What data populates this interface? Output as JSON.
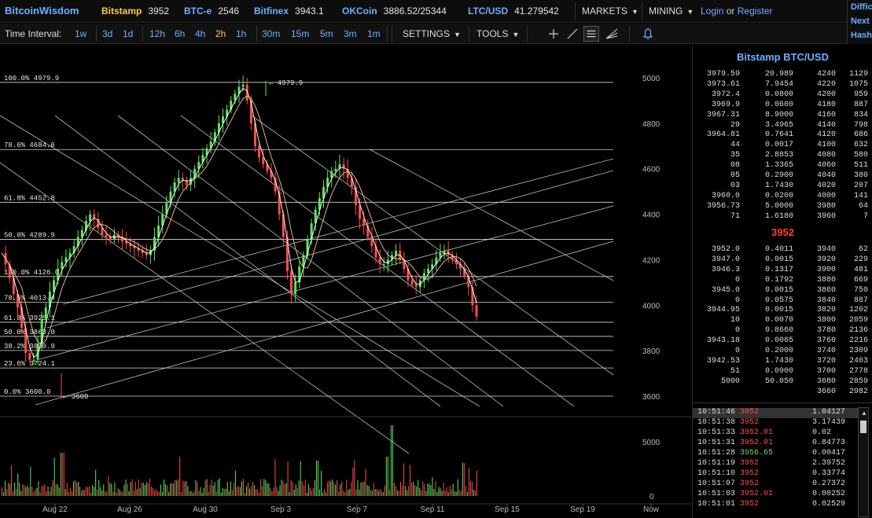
{
  "topbar": {
    "brand": "BitcoinWisdom",
    "tickers": [
      {
        "exchange": "Bitstamp",
        "value": "3952",
        "active": true
      },
      {
        "exchange": "BTC-e",
        "value": "2546",
        "active": false
      },
      {
        "exchange": "Bitfinex",
        "value": "3943.1",
        "active": false
      },
      {
        "exchange": "OKCoin",
        "value": "3886.52/25344",
        "active": false
      },
      {
        "exchange": "LTC/USD",
        "value": "41.279542",
        "active": false
      }
    ],
    "markets_label": "MARKETS",
    "mining_label": "MINING",
    "login_label": "Login",
    "or_label": "or",
    "register_label": "Register",
    "side_items": [
      "Diffic",
      "Next",
      "Hash"
    ]
  },
  "toolbar": {
    "time_interval_label": "Time Interval:",
    "intervals": [
      {
        "label": "1w",
        "active": false
      },
      {
        "label": "3d",
        "active": false
      },
      {
        "label": "1d",
        "active": false
      },
      {
        "label": "12h",
        "active": false
      },
      {
        "label": "6h",
        "active": false
      },
      {
        "label": "4h",
        "active": false
      },
      {
        "label": "2h",
        "active": true
      },
      {
        "label": "1h",
        "active": false
      },
      {
        "label": "30m",
        "active": false
      },
      {
        "label": "15m",
        "active": false
      },
      {
        "label": "5m",
        "active": false
      },
      {
        "label": "3m",
        "active": false
      },
      {
        "label": "1m",
        "active": false
      }
    ],
    "settings_label": "SETTINGS",
    "tools_label": "TOOLS",
    "tool_icons": [
      "crosshair-icon",
      "line-draw-icon",
      "horizontal-lines-icon",
      "fan-lines-icon",
      "alert-bell-icon"
    ]
  },
  "chart_data": {
    "type": "candlestick",
    "price_axis_ticks": [
      "5000",
      "4800",
      "4600",
      "4400",
      "4200",
      "4000",
      "3800",
      "3600"
    ],
    "volume_axis_ticks": [
      "5000",
      "0"
    ],
    "x_tick_labels": [
      "Aug 22",
      "Aug 26",
      "Aug 30",
      "Sep 3",
      "Sep 7",
      "Sep 11",
      "Sep 15",
      "Sep 19",
      "Now"
    ],
    "fib_upper": [
      {
        "label": "100.0% 4979.9",
        "price": 4979.9
      },
      {
        "label": "78.6% 4684.6",
        "price": 4684.6
      },
      {
        "label": "61.8% 4452.8",
        "price": 4452.8
      },
      {
        "label": "50.0% 4289.9",
        "price": 4289.9
      },
      {
        "label": "100.0% 4126.0",
        "price": 4126.0
      }
    ],
    "fib_lower": [
      {
        "label": "78.6% 4013.4",
        "price": 4013.4
      },
      {
        "label": "61.8% 3925.1",
        "price": 3925.1
      },
      {
        "label": "50.0% 3863.0",
        "price": 3863.0
      },
      {
        "label": "38.2% 3800.9",
        "price": 3800.9
      },
      {
        "label": "23.6% 3724.1",
        "price": 3724.1
      },
      {
        "label": "0.0% 3600.0",
        "price": 3600.0
      }
    ],
    "high_marker": "4979.9",
    "low_marker": "3600",
    "ylim": [
      3600,
      5000
    ],
    "price_path": [
      4230,
      4180,
      4120,
      4050,
      3990,
      3900,
      3790,
      3760,
      3760,
      3830,
      3940,
      3990,
      4060,
      4110,
      4160,
      4190,
      4210,
      4230,
      4260,
      4300,
      4330,
      4370,
      4400,
      4380,
      4340,
      4310,
      4300,
      4290,
      4310,
      4300,
      4280,
      4270,
      4260,
      4250,
      4240,
      4230,
      4220,
      4240,
      4300,
      4350,
      4400,
      4450,
      4500,
      4540,
      4560,
      4550,
      4530,
      4560,
      4600,
      4630,
      4660,
      4690,
      4720,
      4760,
      4800,
      4830,
      4860,
      4900,
      4930,
      4960,
      4970,
      4900,
      4800,
      4700,
      4650,
      4620,
      4590,
      4560,
      4500,
      4400,
      4300,
      4150,
      4050,
      4100,
      4170,
      4220,
      4290,
      4360,
      4420,
      4470,
      4520,
      4560,
      4590,
      4600,
      4620,
      4600,
      4560,
      4520,
      4440,
      4380,
      4350,
      4300,
      4260,
      4210,
      4180,
      4180,
      4200,
      4220,
      4240,
      4200,
      4160,
      4110,
      4090,
      4080,
      4110,
      4140,
      4160,
      4180,
      4210,
      4230,
      4240,
      4220,
      4200,
      4180,
      4160,
      4130,
      4080,
      4000,
      3950
    ]
  },
  "orderbook": {
    "title": "Bitstamp BTC/USD",
    "asks": [
      {
        "price": "3979.59",
        "amount": "20.989",
        "sum_price": "4240",
        "sum_amount": "1129"
      },
      {
        "price": "3973.61",
        "amount": "7.9454",
        "sum_price": "4220",
        "sum_amount": "1075"
      },
      {
        "price": "3972.4",
        "amount": "0.0800",
        "sum_price": "4200",
        "sum_amount": "959"
      },
      {
        "price": "3969.9",
        "amount": "0.0600",
        "sum_price": "4180",
        "sum_amount": "887"
      },
      {
        "price": "3967.31",
        "amount": "8.9000",
        "sum_price": "4160",
        "sum_amount": "834"
      },
      {
        "price": "29",
        "amount": "3.4965",
        "sum_price": "4140",
        "sum_amount": "798"
      },
      {
        "price": "3964.81",
        "amount": "0.7641",
        "sum_price": "4120",
        "sum_amount": "686"
      },
      {
        "price": "44",
        "amount": "0.0017",
        "sum_price": "4100",
        "sum_amount": "632"
      },
      {
        "price": "35",
        "amount": "2.8853",
        "sum_price": "4080",
        "sum_amount": "580"
      },
      {
        "price": "08",
        "amount": "1.3365",
        "sum_price": "4060",
        "sum_amount": "511"
      },
      {
        "price": "05",
        "amount": "0.2900",
        "sum_price": "4040",
        "sum_amount": "380"
      },
      {
        "price": "03",
        "amount": "1.7430",
        "sum_price": "4020",
        "sum_amount": "207"
      },
      {
        "price": "3960.0",
        "amount": "0.0200",
        "sum_price": "4000",
        "sum_amount": "141"
      },
      {
        "price": "3956.73",
        "amount": "5.0000",
        "sum_price": "3980",
        "sum_amount": "64"
      },
      {
        "price": "71",
        "amount": "1.6180",
        "sum_price": "3960",
        "sum_amount": "7"
      }
    ],
    "last_price": "3952",
    "bids": [
      {
        "price": "3952.0",
        "amount": "0.4011",
        "sum_price": "3940",
        "sum_amount": "62"
      },
      {
        "price": "3947.0",
        "amount": "0.0015",
        "sum_price": "3920",
        "sum_amount": "229"
      },
      {
        "price": "3946.3",
        "amount": "0.1317",
        "sum_price": "3900",
        "sum_amount": "481"
      },
      {
        "price": "0",
        "amount": "0.1792",
        "sum_price": "3880",
        "sum_amount": "669"
      },
      {
        "price": "3945.0",
        "amount": "0.0015",
        "sum_price": "3860",
        "sum_amount": "750"
      },
      {
        "price": "0",
        "amount": "0.0575",
        "sum_price": "3840",
        "sum_amount": "887"
      },
      {
        "price": "3944.95",
        "amount": "0.0015",
        "sum_price": "3820",
        "sum_amount": "1202"
      },
      {
        "price": "10",
        "amount": "0.0070",
        "sum_price": "3800",
        "sum_amount": "2059"
      },
      {
        "price": "0",
        "amount": "0.8660",
        "sum_price": "3780",
        "sum_amount": "2136"
      },
      {
        "price": "3943.18",
        "amount": "0.0065",
        "sum_price": "3760",
        "sum_amount": "2216"
      },
      {
        "price": "0",
        "amount": "0.2000",
        "sum_price": "3740",
        "sum_amount": "2309"
      },
      {
        "price": "3942.53",
        "amount": "1.7430",
        "sum_price": "3720",
        "sum_amount": "2403"
      },
      {
        "price": "51",
        "amount": "0.0900",
        "sum_price": "3700",
        "sum_amount": "2778"
      },
      {
        "price": "5000",
        "amount": "50.050",
        "sum_price": "3680",
        "sum_amount": "2859"
      },
      {
        "price": "",
        "amount": "",
        "sum_price": "3660",
        "sum_amount": "2982"
      }
    ]
  },
  "trades": [
    {
      "time": "10:51:46",
      "price": "3952",
      "side": "sell",
      "amount": "1.04127"
    },
    {
      "time": "10:51:38",
      "price": "3952",
      "side": "sell",
      "amount": "3.17439"
    },
    {
      "time": "10:51:33",
      "price": "3952.01",
      "side": "sell",
      "amount": "0.02"
    },
    {
      "time": "10:51:31",
      "price": "3952.01",
      "side": "sell",
      "amount": "0.84773"
    },
    {
      "time": "10:51:28",
      "price": "3956.65",
      "side": "buy",
      "amount": "0.00417"
    },
    {
      "time": "10:51:19",
      "price": "3952",
      "side": "sell",
      "amount": "2.39752"
    },
    {
      "time": "10:51:10",
      "price": "3952",
      "side": "sell",
      "amount": "0.33774"
    },
    {
      "time": "10:51:07",
      "price": "3952",
      "side": "sell",
      "amount": "0.27372"
    },
    {
      "time": "10:51:03",
      "price": "3952.01",
      "side": "sell",
      "amount": "0.00252"
    },
    {
      "time": "10:51:01",
      "price": "3952",
      "side": "sell",
      "amount": "0.02529"
    }
  ],
  "colors": {
    "background": "#000000",
    "link": "#6cb0ff",
    "active": "#ffcc44",
    "up": "#5fe25f",
    "down": "#ff4d4d",
    "last_price": "#ff3b3b"
  }
}
